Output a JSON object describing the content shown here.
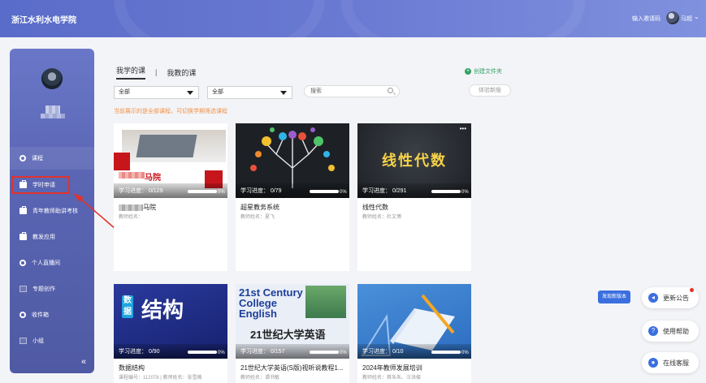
{
  "header": {
    "school_name": "浙江水利水电学院",
    "invite_code": "输入邀请码",
    "username": "马超"
  },
  "sidebar": {
    "items": [
      {
        "label": "课程",
        "icon": "course-icon"
      },
      {
        "label": "学时申请",
        "icon": "briefcase-icon"
      },
      {
        "label": "青年教师助讲考核",
        "icon": "briefcase-icon"
      },
      {
        "label": "教发应用",
        "icon": "briefcase-icon"
      },
      {
        "label": "个人直播间",
        "icon": "live-icon"
      },
      {
        "label": "专题创作",
        "icon": "topic-icon"
      },
      {
        "label": "收件箱",
        "icon": "inbox-icon"
      },
      {
        "label": "小组",
        "icon": "group-icon"
      }
    ],
    "collapse": "«"
  },
  "tabs": {
    "my_courses": "我学的课",
    "separator": "|",
    "teaching": "我教的课"
  },
  "create_folder": "创建文件夹",
  "filters": {
    "select1": "全部",
    "select2": "全部",
    "search_placeholder": "搜索",
    "trial": "体验新版"
  },
  "hint": "当前展示的是全部课程，可切换学期筛选课程",
  "courses": [
    {
      "title": "马院",
      "teacher": "教师姓名：",
      "progress": "学习进度： 0/129",
      "pct": "0%",
      "cover_text": "马院"
    },
    {
      "title": "超星教务系统",
      "teacher": "教师姓名：夏飞",
      "progress": "学习进度： 0/79",
      "pct": "0%"
    },
    {
      "title": "线性代数",
      "teacher": "教师姓名：杜文博",
      "progress": "学习进度： 0/291",
      "pct": "0%",
      "cover_text": "线性代数"
    },
    {
      "title": "数据结构",
      "teacher": "课程编号：112078 | 教师姓名：张雪薇",
      "progress": "学习进度： 0/90",
      "pct": "0%",
      "cover_text": "结构",
      "cover_small": "数据"
    },
    {
      "title": "21世纪大学英语(S版)视听说教程1...",
      "teacher": "教师姓名：谭书敏",
      "progress": "学习进度： 0/157",
      "pct": "0%",
      "cover_text": "21st Century College English",
      "cover_sub": "21世纪大学英语"
    },
    {
      "title": "2024年教师发展培训",
      "teacher": "教师姓名：蒋朱朱、汪洪樑",
      "progress": "学习进度： 0/10",
      "pct": "0%"
    }
  ],
  "float": {
    "new_version": "发现新版本",
    "announce": "更新公告",
    "help": "使用帮助",
    "service": "在线客服"
  },
  "colors": {
    "header_start": "#5a6cc9",
    "header_end": "#8091de",
    "sidebar": "#5a66b4",
    "highlight": "#e1322b",
    "accent_green": "#33a065",
    "hint_orange": "#f0924a",
    "button_blue": "#3b6fe0"
  }
}
